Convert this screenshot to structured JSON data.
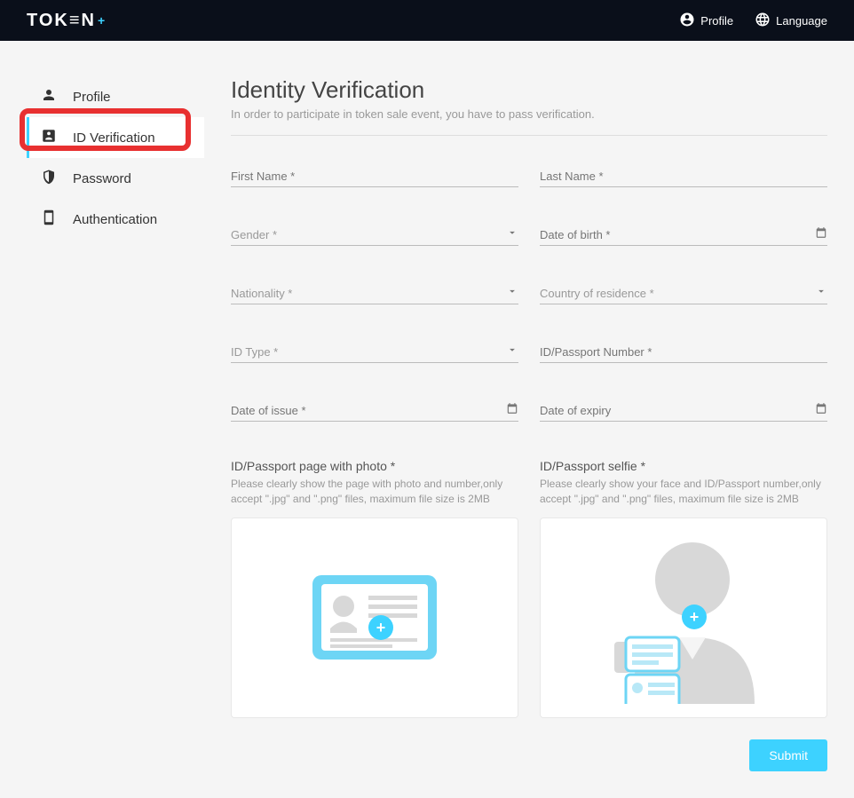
{
  "header": {
    "logo_text": "TOK≡N",
    "logo_plus": "+",
    "profile_label": "Profile",
    "language_label": "Language"
  },
  "sidebar": {
    "items": [
      {
        "label": "Profile"
      },
      {
        "label": "ID Verification"
      },
      {
        "label": "Password"
      },
      {
        "label": "Authentication"
      }
    ]
  },
  "main": {
    "title": "Identity Verification",
    "subtitle": "In order to participate in token sale event, you have to pass verification.",
    "fields": {
      "first_name": "First Name *",
      "last_name": "Last Name *",
      "gender": "Gender *",
      "dob": "Date of birth *",
      "nationality": "Nationality *",
      "residence": "Country of residence *",
      "id_type": "ID Type *",
      "id_number": "ID/Passport Number *",
      "issue": "Date of issue *",
      "expiry": "Date of expiry"
    },
    "upload": {
      "photo_title": "ID/Passport page with photo *",
      "photo_hint": "Please clearly show the page with photo and number,only accept \".jpg\" and \".png\" files, maximum file size is 2MB",
      "selfie_title": "ID/Passport selfie *",
      "selfie_hint": "Please clearly show your face and ID/Passport number,only accept \".jpg\" and \".png\" files, maximum file size is 2MB"
    },
    "submit_label": "Submit"
  }
}
